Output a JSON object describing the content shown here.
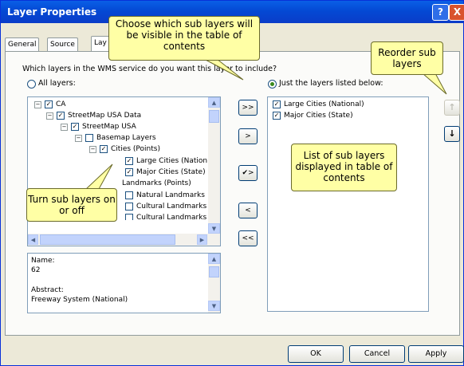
{
  "window": {
    "title": "Layer Properties",
    "help_label": "?",
    "close_label": "X"
  },
  "tabs": [
    "General",
    "Source",
    "Lay"
  ],
  "question": "Which layers in the WMS service do you want this layer to include?",
  "radio_all": "All layers:",
  "radio_listed": "Just the layers listed below:",
  "tree": [
    {
      "label": "CA",
      "checked": true,
      "expander": "−"
    },
    {
      "label": "StreetMap USA  Data",
      "checked": true,
      "expander": "−"
    },
    {
      "label": "StreetMap USA",
      "checked": true,
      "expander": "−"
    },
    {
      "label": "Basemap Layers",
      "checked": false,
      "expander": "−"
    },
    {
      "label": "Cities (Points)",
      "checked": true,
      "expander": "−"
    },
    {
      "label": "Large Cities (Nation",
      "checked": true,
      "expander": ""
    },
    {
      "label": "Major Cities (State)",
      "checked": true,
      "expander": ""
    },
    {
      "label": "Landmarks (Points)",
      "checked": false,
      "expander": ""
    },
    {
      "label": "Natural Landmarks",
      "checked": false,
      "expander": ""
    },
    {
      "label": "Cultural Landmarks",
      "checked": false,
      "expander": ""
    },
    {
      "label": "Cultural Landmarks",
      "checked": false,
      "expander": ""
    }
  ],
  "info": {
    "name_label": "Name:",
    "name_value": "62",
    "abstract_label": "Abstract:",
    "abstract_value": "Freeway System (National)"
  },
  "move_buttons": {
    "add_all": ">>",
    "add": ">",
    "add_checked": "✔>",
    "remove": "<",
    "remove_all": "<<"
  },
  "list": [
    {
      "label": "Large Cities (National)",
      "checked": true
    },
    {
      "label": "Major Cities (State)",
      "checked": true
    }
  ],
  "reorder": {
    "up": "↑",
    "down": "↓"
  },
  "buttons": {
    "ok": "OK",
    "cancel": "Cancel",
    "apply": "Apply"
  },
  "callouts": {
    "choose": "Choose which sub layers will be visible in the table of contents",
    "reorder": "Reorder sub layers",
    "turn": "Turn sub layers on or off",
    "list": "List of sub layers displayed in table of contents"
  },
  "colors": {
    "callout_bg": "#ffffa5",
    "title_bar": "#0449d4",
    "dialog_bg": "#ece9d8"
  }
}
